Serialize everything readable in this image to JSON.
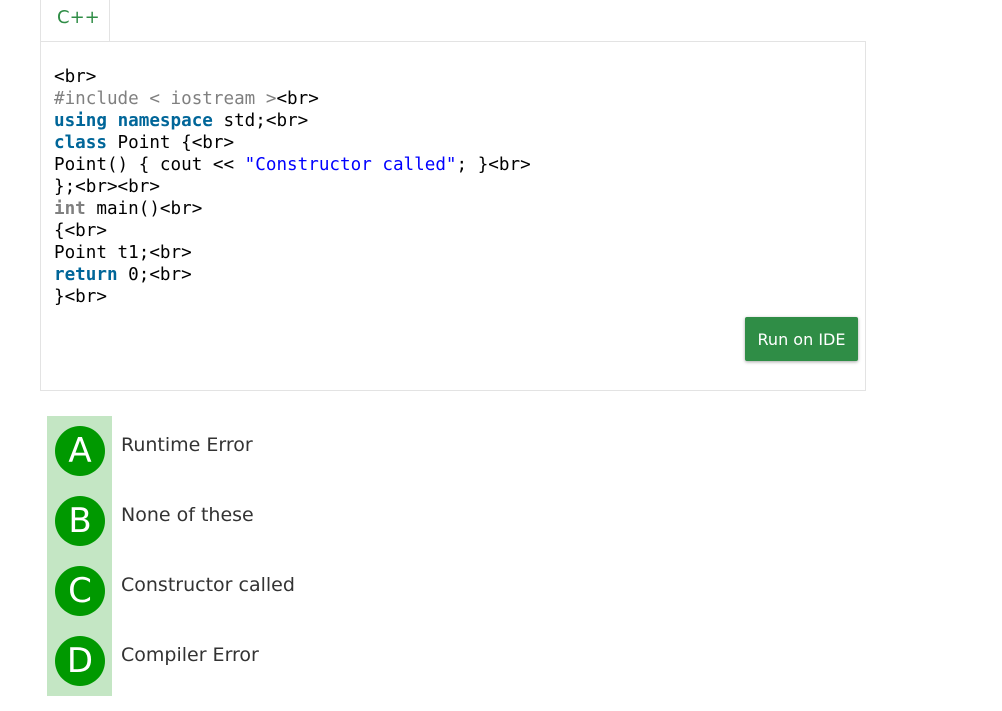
{
  "tab": {
    "language": "C++"
  },
  "code": {
    "lines": [
      [
        {
          "t": "<br>",
          "c": "plain"
        }
      ],
      [
        {
          "t": "#include",
          "c": "pp"
        },
        {
          "t": " < iostream >",
          "c": "pp"
        },
        {
          "t": "<br>",
          "c": "plain"
        }
      ],
      [
        {
          "t": "using",
          "c": "kw"
        },
        {
          "t": " ",
          "c": "plain"
        },
        {
          "t": "namespace",
          "c": "kw"
        },
        {
          "t": " std;<br>",
          "c": "plain"
        }
      ],
      [
        {
          "t": "class",
          "c": "kw"
        },
        {
          "t": " Point {<br>",
          "c": "plain"
        }
      ],
      [
        {
          "t": "Point() { cout << ",
          "c": "plain"
        },
        {
          "t": "\"Constructor called\"",
          "c": "str"
        },
        {
          "t": "; }<br>",
          "c": "plain"
        }
      ],
      [
        {
          "t": "};<br><br>",
          "c": "plain"
        }
      ],
      [
        {
          "t": "int",
          "c": "type"
        },
        {
          "t": " main()<br>",
          "c": "plain"
        }
      ],
      [
        {
          "t": "{<br>",
          "c": "plain"
        }
      ],
      [
        {
          "t": "Point t1;<br>",
          "c": "plain"
        }
      ],
      [
        {
          "t": "return",
          "c": "kw"
        },
        {
          "t": " 0;<br>",
          "c": "plain"
        }
      ],
      [
        {
          "t": "}<br>",
          "c": "plain"
        }
      ]
    ]
  },
  "run_button": {
    "label": "Run on IDE"
  },
  "options": [
    {
      "letter": "A",
      "text": "Runtime Error"
    },
    {
      "letter": "B",
      "text": "None of these"
    },
    {
      "letter": "C",
      "text": "Constructor called"
    },
    {
      "letter": "D",
      "text": "Compiler Error"
    }
  ],
  "colors": {
    "accent_green": "#2f8d46",
    "option_circle": "#009900",
    "option_strip": "#c4e6c4",
    "keyword": "#006699",
    "string": "#0000ff",
    "preprocessor": "#808080"
  }
}
